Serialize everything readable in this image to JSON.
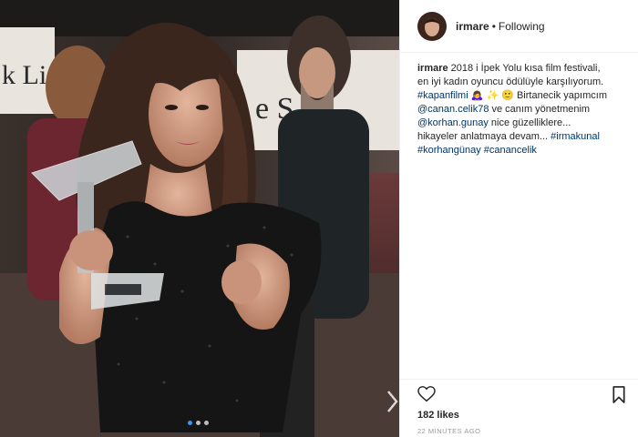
{
  "post": {
    "username": "irmare",
    "separator": "•",
    "follow_status": "Following",
    "caption": {
      "username": "irmare",
      "segments": [
        {
          "t": "text",
          "v": "2018 i İpek Yolu kısa film festivali, en iyi kadın oyuncu ödülüyle karşılıyorum. "
        },
        {
          "t": "tag",
          "v": "#kapanfilmi"
        },
        {
          "t": "text",
          "v": " 🙇‍♀️ ✨ 🙂 Birtanecik yapımcım "
        },
        {
          "t": "mention",
          "v": "@canan.celik78"
        },
        {
          "t": "text",
          "v": " ve canım yönetmenim "
        },
        {
          "t": "mention",
          "v": "@korhan.gunay"
        },
        {
          "t": "text",
          "v": " nice güzelliklere... hikayeler anlatmaya devam... "
        },
        {
          "t": "tag",
          "v": "#irmakunal"
        },
        {
          "t": "text",
          "v": " "
        },
        {
          "t": "tag",
          "v": "#korhangünay"
        },
        {
          "t": "text",
          "v": " "
        },
        {
          "t": "tag",
          "v": "#canancelik"
        }
      ]
    },
    "likes": "182 likes",
    "time": "22 MINUTES AGO",
    "carousel": {
      "count": 3,
      "active_index": 0
    },
    "colors": {
      "link": "#003569",
      "active_dot": "#3897f0",
      "muted": "#999999"
    }
  },
  "icons": {
    "heart": "heart-icon",
    "bookmark": "bookmark-icon",
    "next": "chevron-right-icon"
  }
}
